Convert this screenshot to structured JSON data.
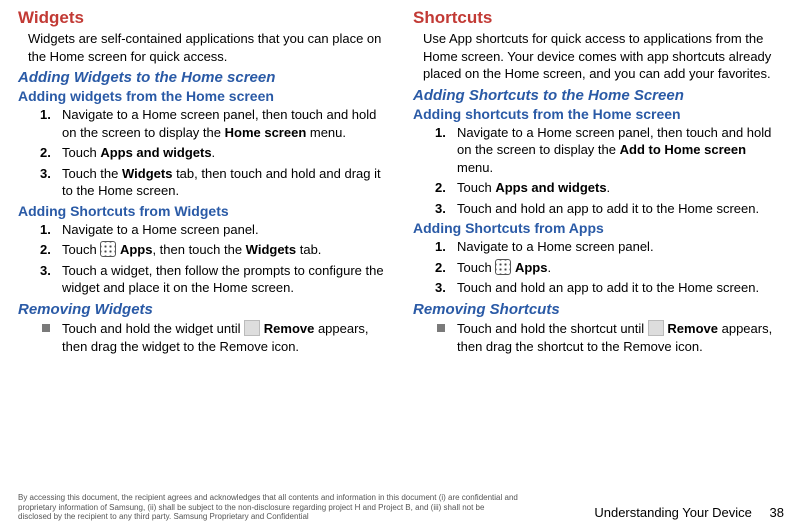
{
  "left": {
    "title": "Widgets",
    "intro": "Widgets are self-contained applications that you can place on the Home screen for quick access.",
    "addSection": {
      "heading": "Adding Widgets to the Home screen",
      "sub1": {
        "heading": "Adding widgets from the Home screen",
        "step1_a": "Navigate to a Home screen panel, then touch and hold on the screen to display the ",
        "step1_b": "Home screen",
        "step1_c": " menu.",
        "step2_a": "Touch ",
        "step2_b": "Apps and widgets",
        "step2_c": ".",
        "step3_a": "Touch the ",
        "step3_b": "Widgets",
        "step3_c": " tab, then touch and hold and drag it to the Home screen."
      },
      "sub2": {
        "heading": "Adding Shortcuts from Widgets",
        "step1": "Navigate to a Home screen panel.",
        "step2_a": "Touch ",
        "step2_b": "Apps",
        "step2_c": ", then touch the ",
        "step2_d": "Widgets",
        "step2_e": " tab.",
        "step3": "Touch a widget, then follow the prompts to configure the widget and place it on the Home screen."
      }
    },
    "removeSection": {
      "heading": "Removing Widgets",
      "bullet_a": "Touch and hold the widget until ",
      "bullet_b": "Remove",
      "bullet_c": " appears, then drag the widget to the Remove icon."
    }
  },
  "right": {
    "title": "Shortcuts",
    "intro": "Use App shortcuts for quick access to applications from the Home screen. Your device comes with app shortcuts already placed on the Home screen, and you can add your favorites.",
    "addSection": {
      "heading": "Adding Shortcuts to the Home Screen",
      "sub1": {
        "heading": "Adding shortcuts from the Home screen",
        "step1_a": "Navigate to a Home screen panel, then touch and hold on the screen to display the ",
        "step1_b": "Add to Home screen",
        "step1_c": " menu.",
        "step2_a": "Touch ",
        "step2_b": "Apps and widgets",
        "step2_c": ".",
        "step3": "Touch and hold an app to add it to the Home screen."
      },
      "sub2": {
        "heading": "Adding Shortcuts from Apps",
        "step1": "Navigate to a Home screen panel.",
        "step2_a": "Touch ",
        "step2_b": "Apps",
        "step2_c": ".",
        "step3": "Touch and hold an app to add it to the Home screen."
      }
    },
    "removeSection": {
      "heading": "Removing Shortcuts",
      "bullet_a": "Touch and hold the shortcut until ",
      "bullet_b": "Remove",
      "bullet_c": " appears, then drag the shortcut to the Remove icon."
    }
  },
  "footer": {
    "disclaimer": "By accessing this document, the recipient agrees and acknowledges that all contents and information in this document (i) are confidential and proprietary information of Samsung, (ii) shall be subject to the non-disclosure regarding project H and Project B, and (iii) shall not be disclosed by the recipient to any third party. Samsung Proprietary and Confidential",
    "section": "Understanding Your Device",
    "page": "38"
  }
}
